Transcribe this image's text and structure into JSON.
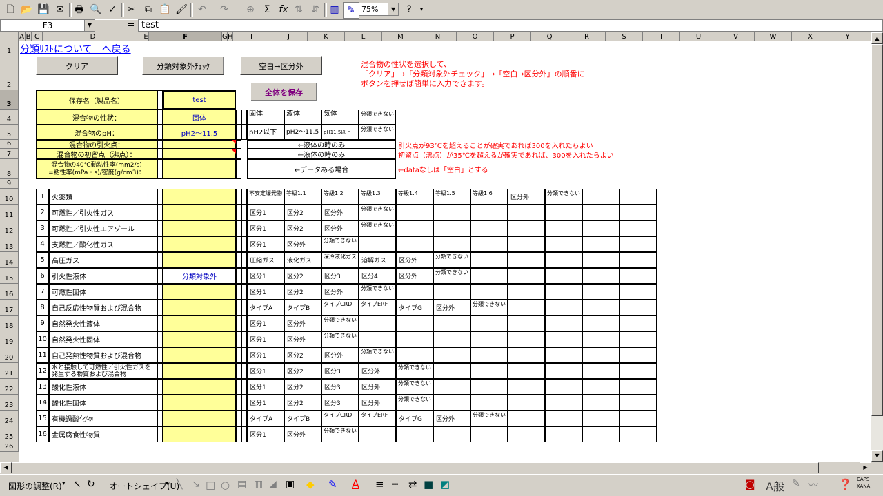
{
  "toolbar": {
    "zoom": "75%",
    "icons": [
      "new-icon",
      "open-icon",
      "save-icon",
      "permission-icon",
      "print-icon",
      "print-preview-icon",
      "spelling-icon",
      "cut-icon",
      "copy-icon",
      "paste-icon",
      "format-painter-icon",
      "undo-icon",
      "redo-icon",
      "hyperlink-icon",
      "autosum-icon",
      "function-icon",
      "sort-ascending-icon",
      "sort-descending-icon",
      "chart-wizard-icon",
      "drawing-icon",
      "help-icon"
    ]
  },
  "formula_bar": {
    "name_box": "F3",
    "equals": "=",
    "content": "test"
  },
  "columns": [
    "A",
    "B",
    "C",
    "D",
    "E",
    "F",
    "G",
    "H",
    "I",
    "J",
    "K",
    "L",
    "M",
    "N",
    "O",
    "P",
    "Q",
    "R",
    "S",
    "T",
    "U",
    "V",
    "W",
    "X",
    "Y"
  ],
  "rows": [
    "1",
    "2",
    "3",
    "4",
    "5",
    "6",
    "7",
    "8",
    "9",
    "10",
    "11",
    "12",
    "13",
    "14",
    "15",
    "16",
    "17",
    "18",
    "19",
    "20",
    "21",
    "22",
    "23",
    "24",
    "25",
    "26"
  ],
  "sheet": {
    "link": "分類ﾘｽﾄについて　へ戻る",
    "buttons": {
      "clear": "クリア",
      "check": "分類対象外ﾁｪｯｸ",
      "blank": "空白→区分外",
      "save_all": "全体を保存"
    },
    "instructions": [
      "混合物の性状を選択して、",
      "「クリア」→「分類対象外チェック」→「空白→区分外」の順番に",
      "ボタンを押せば簡単に入力できます。"
    ],
    "form": {
      "save_name_label": "保存名（製品名）",
      "save_name_value": "test",
      "state_label": "混合物の性状：",
      "state_value": "固体",
      "ph_label": "混合物のpH：",
      "ph_value": "pH2～11.5",
      "flash_label": "混合物の引火点：",
      "boil_label": "混合物の初留点（沸点）：",
      "visc_label_1": "混合物の40℃動粘性率(mm2/s)",
      "visc_label_2": "=粘性率(mPa・s)/密度(g/cm3)："
    },
    "state_options": [
      "固体",
      "液体",
      "気体",
      "分類できない"
    ],
    "ph_options": [
      "pH2以下",
      "pH2～11.5",
      "pH11.5以上",
      "分類できない"
    ],
    "liquid_only": "←液体の時のみ",
    "data_case": "←データある場合",
    "notes": {
      "flash": "引火点が93℃を超えることが確実であれば300を入れたらよい",
      "boil": "初留点（沸点）が35℃を超えるが確実であれば、300を入れたらよい",
      "data": "←dataなしは「空白」とする"
    },
    "hazards": [
      {
        "no": "1",
        "name": "火薬類",
        "f": "",
        "opts": [
          "不安定爆発物",
          "等級1.1",
          "等級1.2",
          "等級1.3",
          "等級1.4",
          "等級1.5",
          "等級1.6",
          "区分外",
          "分類できない"
        ]
      },
      {
        "no": "2",
        "name": "可燃性／引火性ガス",
        "f": "",
        "opts": [
          "区分1",
          "区分2",
          "区分外",
          "分類できない"
        ]
      },
      {
        "no": "3",
        "name": "可燃性／引火性エアゾール",
        "f": "",
        "opts": [
          "区分1",
          "区分2",
          "区分外",
          "分類できない"
        ]
      },
      {
        "no": "4",
        "name": "支燃性／酸化性ガス",
        "f": "",
        "opts": [
          "区分1",
          "区分外",
          "分類できない"
        ]
      },
      {
        "no": "5",
        "name": "高圧ガス",
        "f": "",
        "opts": [
          "圧縮ガス",
          "液化ガス",
          "深冷液化ガス",
          "溶解ガス",
          "区分外",
          "分類できない"
        ]
      },
      {
        "no": "6",
        "name": "引火性液体",
        "f": "分類対象外",
        "opts": [
          "区分1",
          "区分2",
          "区分3",
          "区分4",
          "区分外",
          "分類できない"
        ]
      },
      {
        "no": "7",
        "name": "可燃性固体",
        "f": "",
        "opts": [
          "区分1",
          "区分2",
          "区分外",
          "分類できない"
        ]
      },
      {
        "no": "8",
        "name": "自己反応性物質および混合物",
        "f": "",
        "opts": [
          "タイプA",
          "タイプB",
          "タイプCRD",
          "タイプERF",
          "タイプG",
          "区分外",
          "分類できない"
        ]
      },
      {
        "no": "9",
        "name": "自然発火性液体",
        "f": "",
        "opts": [
          "区分1",
          "区分外",
          "分類できない"
        ]
      },
      {
        "no": "10",
        "name": "自然発火性固体",
        "f": "",
        "opts": [
          "区分1",
          "区分外",
          "分類できない"
        ]
      },
      {
        "no": "11",
        "name": "自己発熱性物質および混合物",
        "f": "",
        "opts": [
          "区分1",
          "区分2",
          "区分外",
          "分類できない"
        ]
      },
      {
        "no": "12",
        "name": "水と接触して可燃性／引火性ガスを発生する物質および混合物",
        "f": "",
        "opts": [
          "区分1",
          "区分2",
          "区分3",
          "区分外",
          "分類できない"
        ]
      },
      {
        "no": "13",
        "name": "酸化性液体",
        "f": "",
        "opts": [
          "区分1",
          "区分2",
          "区分3",
          "区分外",
          "分類できない"
        ]
      },
      {
        "no": "14",
        "name": "酸化性固体",
        "f": "",
        "opts": [
          "区分1",
          "区分2",
          "区分3",
          "区分外",
          "分類できない"
        ]
      },
      {
        "no": "15",
        "name": "有機過酸化物",
        "f": "",
        "opts": [
          "タイプA",
          "タイプB",
          "タイプCRD",
          "タイプERF",
          "タイプG",
          "区分外",
          "分類できない"
        ]
      },
      {
        "no": "16",
        "name": "金属腐食性物質",
        "f": "",
        "opts": [
          "区分1",
          "区分外",
          "分類できない"
        ]
      }
    ]
  },
  "drawing_toolbar": {
    "adjust": "図形の調整(R)",
    "autoshape": "オートシェイプ(U)",
    "icons": [
      "select-arrow-icon",
      "rotate-icon",
      "line-icon",
      "arrow-icon",
      "rectangle-icon",
      "oval-icon",
      "textbox-icon",
      "vertical-textbox-icon",
      "wordart-icon",
      "clipart-icon",
      "fill-color-icon",
      "line-color-icon",
      "font-color-icon",
      "line-style-icon",
      "dash-style-icon",
      "arrow-style-icon",
      "shadow-icon",
      "3d-icon"
    ],
    "ime_text": "A般",
    "caps": "CAPS",
    "kana": "KANA"
  }
}
